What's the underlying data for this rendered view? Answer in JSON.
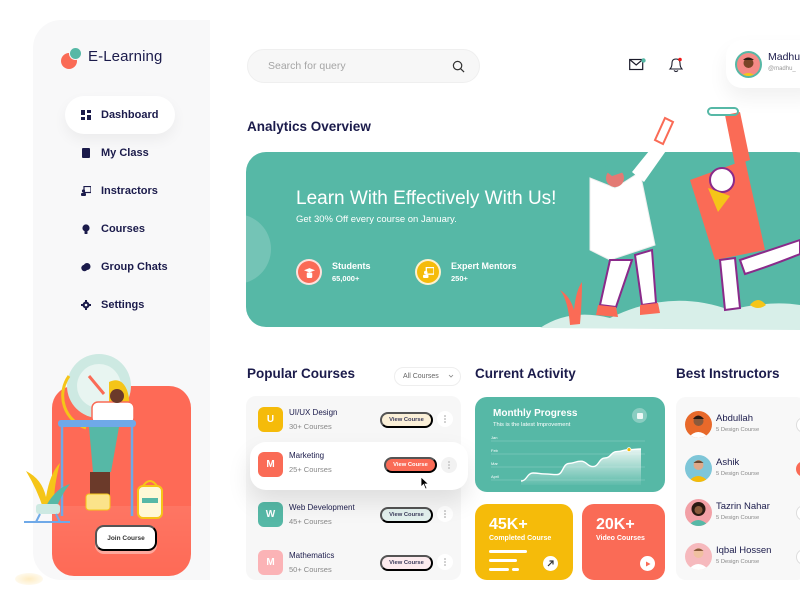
{
  "app": {
    "brand": "E-Learning"
  },
  "colors": {
    "primary": "#56b8a6",
    "accent": "#fa6b56",
    "yellow": "#f5bb0a",
    "text": "#1b1b4b"
  },
  "sidebar": {
    "items": [
      {
        "label": "Dashboard",
        "icon": "dashboard-icon",
        "active": true
      },
      {
        "label": "My Class",
        "icon": "book-icon",
        "active": false
      },
      {
        "label": "Instractors",
        "icon": "presentation-icon",
        "active": false
      },
      {
        "label": "Courses",
        "icon": "lightbulb-icon",
        "active": false
      },
      {
        "label": "Group Chats",
        "icon": "chat-icon",
        "active": false
      },
      {
        "label": "Settings",
        "icon": "gear-icon",
        "active": false
      }
    ],
    "promo": {
      "button": "Join Course"
    }
  },
  "header": {
    "search": {
      "placeholder": "Search for query",
      "value": ""
    },
    "user": {
      "name": "Madhu",
      "handle": "@madhu_"
    }
  },
  "analytics": {
    "title": "Analytics Overview",
    "banner": {
      "title": "Learn With Effectively With Us!",
      "subtitle": "Get 30% Off every course on January.",
      "stats": [
        {
          "label": "Students",
          "value": "65,000+",
          "icon": "graduate-icon",
          "color": "#fa6b56"
        },
        {
          "label": "Expert Mentors",
          "value": "250+",
          "icon": "mentor-icon",
          "color": "#f5bb0a"
        }
      ]
    }
  },
  "popular_courses": {
    "title": "Popular Courses",
    "filter": "All Courses",
    "courses": [
      {
        "letter": "U",
        "name": "UI/UX Design",
        "count": "30+ Courses",
        "button": "View Course",
        "color": "#f5bb0a",
        "btn_bg": "#fbf0d8",
        "highlight": false
      },
      {
        "letter": "M",
        "name": "Marketing",
        "count": "25+ Courses",
        "button": "View Course",
        "color": "#fa6b56",
        "btn_bg": "#fa6b56",
        "highlight": true
      },
      {
        "letter": "W",
        "name": "Web Development",
        "count": "45+ Courses",
        "button": "View Course",
        "color": "#56b8a6",
        "btn_bg": "#e3f1ee",
        "highlight": false
      },
      {
        "letter": "M",
        "name": "Mathematics",
        "count": "50+ Courses",
        "button": "View Course",
        "color": "#fbb3b6",
        "btn_bg": "#fcebee",
        "highlight": false
      }
    ]
  },
  "current_activity": {
    "title": "Current Activity",
    "progress": {
      "title": "Monthly Progress",
      "subtitle": "This is the latest Improvement",
      "y_labels": [
        "Jan",
        "Feb",
        "Mar",
        "April"
      ]
    },
    "completed": {
      "value": "45K+",
      "label": "Completed Course"
    },
    "videos": {
      "value": "20K+",
      "label": "Video Courses"
    }
  },
  "chart_data": {
    "type": "area",
    "title": "Monthly Progress",
    "subtitle": "This is the latest Improvement",
    "y_tick_labels": [
      "Jan",
      "Feb",
      "Mar",
      "April"
    ],
    "x": [
      0,
      1,
      2,
      3,
      4,
      5,
      6,
      7,
      8,
      9,
      10
    ],
    "values": [
      0.0,
      0.25,
      0.22,
      0.2,
      0.55,
      0.62,
      0.45,
      0.72,
      0.92,
      0.98,
      1.0
    ],
    "ylim": [
      0,
      1
    ],
    "grid": true,
    "highlight_last_point": true
  },
  "instructors": {
    "title": "Best Instructors",
    "list": [
      {
        "name": "Abdullah",
        "sub": "5 Design Course",
        "bg": "#e8692a",
        "active": false
      },
      {
        "name": "Ashik",
        "sub": "5 Design Course",
        "bg": "#7ec6d8",
        "active": true
      },
      {
        "name": "Tazrin Nahar",
        "sub": "5 Design Course",
        "bg": "#f2a0a6",
        "active": false
      },
      {
        "name": "Iqbal Hossen",
        "sub": "5 Design Course",
        "bg": "#f6b9bd",
        "active": false
      }
    ]
  }
}
